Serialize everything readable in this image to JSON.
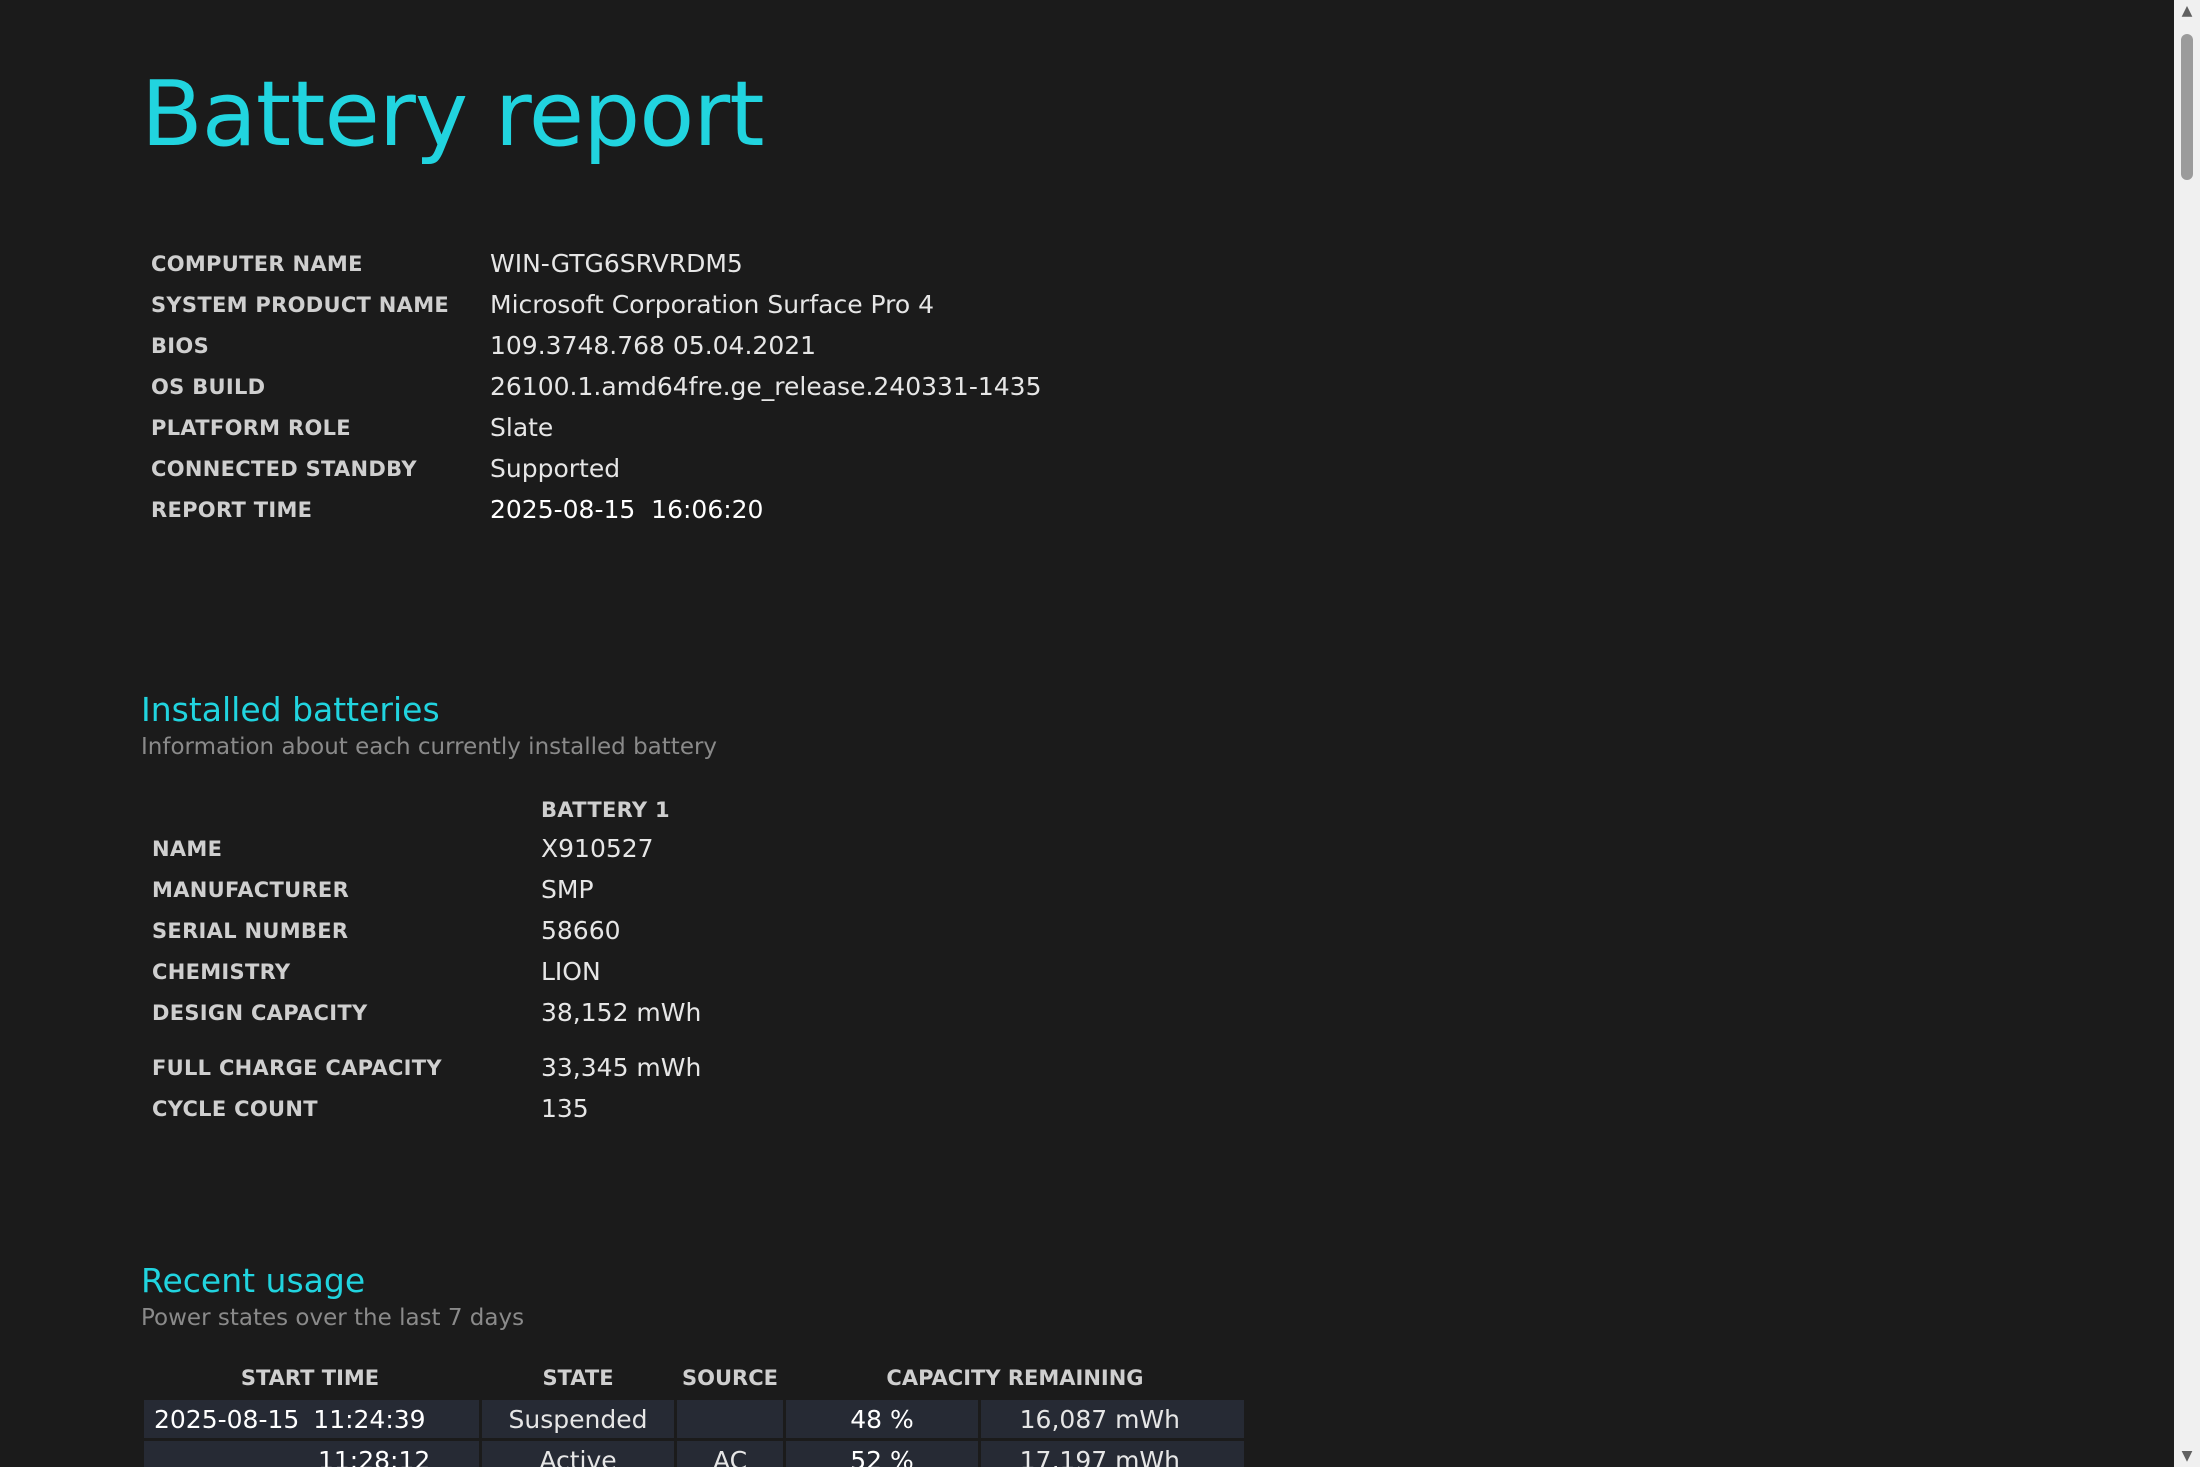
{
  "page": {
    "title": "Battery report"
  },
  "system_info": [
    {
      "label": "COMPUTER NAME",
      "value": "WIN-GTG6SRVRDM5"
    },
    {
      "label": "SYSTEM PRODUCT NAME",
      "value": "Microsoft Corporation Surface Pro 4"
    },
    {
      "label": "BIOS",
      "value": "109.3748.768 05.04.2021"
    },
    {
      "label": "OS BUILD",
      "value": "26100.1.amd64fre.ge_release.240331-1435"
    },
    {
      "label": "PLATFORM ROLE",
      "value": "Slate"
    },
    {
      "label": "CONNECTED STANDBY",
      "value": "Supported"
    },
    {
      "label": "REPORT TIME",
      "value": "2025-08-15  16:06:20"
    }
  ],
  "installed_batteries": {
    "heading": "Installed batteries",
    "subtitle": "Information about each currently installed battery",
    "column_header": "BATTERY 1",
    "rows": [
      {
        "label": "NAME",
        "value": "X910527"
      },
      {
        "label": "MANUFACTURER",
        "value": "SMP"
      },
      {
        "label": "SERIAL NUMBER",
        "value": "58660"
      },
      {
        "label": "CHEMISTRY",
        "value": "LION"
      },
      {
        "label": "DESIGN CAPACITY",
        "value": "38,152 mWh"
      },
      {
        "label": "FULL CHARGE CAPACITY",
        "value": "33,345 mWh"
      },
      {
        "label": "CYCLE COUNT",
        "value": "135"
      }
    ]
  },
  "recent_usage": {
    "heading": "Recent usage",
    "subtitle": "Power states over the last 7 days",
    "columns": {
      "start_time": "START TIME",
      "state": "STATE",
      "source": "SOURCE",
      "capacity_remaining": "CAPACITY REMAINING"
    },
    "rows": [
      {
        "date": "2025-08-15",
        "time": "11:24:39",
        "state": "Suspended",
        "source": "",
        "percent": "48 %",
        "mwh": "16,087 mWh"
      },
      {
        "date": "",
        "time": "11:28:12",
        "state": "Active",
        "source": "AC",
        "percent": "52 %",
        "mwh": "17,197 mWh"
      }
    ]
  },
  "scrollbar": {
    "up_glyph": "▲",
    "down_glyph": "▼"
  }
}
